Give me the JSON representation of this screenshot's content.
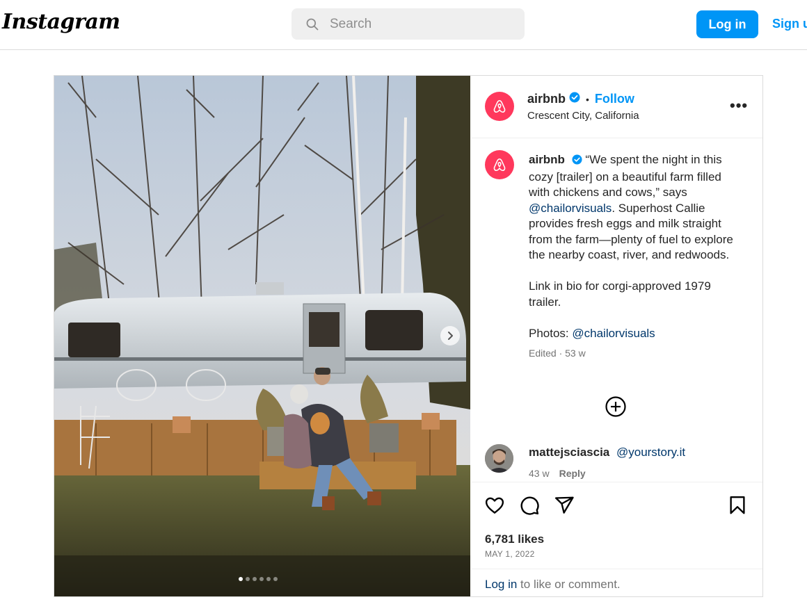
{
  "header": {
    "logo_text": "Instagram",
    "search_placeholder": "Search",
    "login_label": "Log in",
    "signup_label": "Sign up"
  },
  "post": {
    "username": "airbnb",
    "separator": "•",
    "follow_label": "Follow",
    "location": "Crescent City, California",
    "more_label": "•••",
    "caption": {
      "username": "airbnb",
      "part1": "“We spent the night in this cozy [trailer] on a beautiful farm filled with chickens and cows,” says ",
      "mention1": "@chailorvisuals",
      "part2": ". Superhost Callie provides fresh eggs and milk straight from the farm—plenty of fuel to explore the nearby coast, river, and redwoods.",
      "paragraph2": "Link in bio for corgi-approved 1979 trailer.",
      "photos_label": "Photos: ",
      "mention2": "@chailorvisuals",
      "edited": "Edited · 53 w"
    },
    "comment": {
      "username": "mattejsciascia",
      "mention": "@yourstory.it",
      "time": "43 w",
      "reply_label": "Reply"
    },
    "likes": "6,781 likes",
    "date": "MAY 1, 2022",
    "login_prompt": {
      "link": "Log in",
      "text": " to like or comment."
    },
    "carousel": {
      "count": 6,
      "active_index": 0
    }
  },
  "icons": {
    "search": "search-icon",
    "verified": "verified-badge-icon",
    "more": "more-options-icon",
    "expand": "plus-circle-icon",
    "like": "heart-icon",
    "comment": "comment-icon",
    "share": "send-icon",
    "save": "bookmark-icon",
    "next": "chevron-right-icon"
  },
  "colors": {
    "accent": "#0095f6",
    "brand_avatar": "#ff385c",
    "mention": "#00376b",
    "verified": "#0095f6"
  }
}
